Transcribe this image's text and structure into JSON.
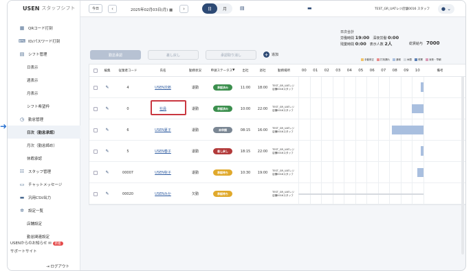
{
  "app": {
    "brand": "USEN",
    "brand_sub": "スタッフシフト"
  },
  "sidebar": {
    "items": [
      {
        "label": "QRコード打刻",
        "icon": "qr-icon",
        "sub": false
      },
      {
        "label": "ID/パスワード打刻",
        "icon": "keyboard-icon",
        "sub": false
      },
      {
        "label": "シフト管理",
        "icon": "calendar-icon",
        "sub": false
      },
      {
        "label": "日表示",
        "sub": true
      },
      {
        "label": "週表示",
        "sub": true
      },
      {
        "label": "月表示",
        "sub": true
      },
      {
        "label": "シフト希望枠",
        "sub": true
      },
      {
        "label": "勤怠管理",
        "icon": "check-circle-icon",
        "sub": false
      },
      {
        "label": "日次（勤怠承認）",
        "sub": true,
        "active": true
      },
      {
        "label": "月次（勤怠締め）",
        "sub": true
      },
      {
        "label": "休暇承認",
        "sub": true
      },
      {
        "label": "スタッフ管理",
        "icon": "people-icon",
        "sub": false
      },
      {
        "label": "チャットメッセージ",
        "icon": "chat-icon",
        "sub": false
      },
      {
        "label": "汎用CSV出力",
        "icon": "csv-icon",
        "sub": false
      },
      {
        "label": "設定一覧",
        "icon": "gear-icon",
        "sub": false
      },
      {
        "label": "店舗設定",
        "sub": true
      },
      {
        "label": "勤怠関連設定",
        "sub": true
      }
    ],
    "news": "USENからのお知らせ",
    "news_badge": "新着",
    "support": "サポートサイト",
    "logout": "ログアウト"
  },
  "topbar": {
    "today": "今日",
    "date": "2025年02月03日(月)",
    "view_day": "日",
    "view_month": "月",
    "shop": "TEST_GR_UATレジ店舗0016 スタッフ"
  },
  "summary": {
    "line1": "日次合計",
    "labor_label": "労働時間",
    "labor": "19:00",
    "night_label": "深夜労働",
    "night": "0:00",
    "overtime_label": "残業時間",
    "overtime": "0:00",
    "people_label": "表示人数",
    "people": "2人",
    "total_label": "総賃給与",
    "total": "7000"
  },
  "actions": {
    "approve": "勤怠承認",
    "reject": "差し戻し",
    "cancel": "承認取り消し",
    "add": "追加"
  },
  "legend": [
    {
      "label": "手動修正",
      "color": "#f0c36a"
    },
    {
      "label": "打刻漏れ",
      "color": "#e98c8c"
    },
    {
      "label": "通常",
      "color": "#a9bfdf"
    },
    {
      "label": "休憩",
      "color": "#d5d9de"
    },
    {
      "label": "残業",
      "color": "#5a7fb5"
    },
    {
      "label": "深夜・早朝",
      "color": "#d99bb6"
    }
  ],
  "table": {
    "headers": [
      "編集",
      "従業者コード",
      "氏名",
      "勤務状況",
      "申請ステータス",
      "出社",
      "退社",
      "勤務場所"
    ],
    "hours": [
      "00",
      "01",
      "02",
      "03",
      "04",
      "05",
      "06",
      "07",
      "08",
      "09",
      "10"
    ],
    "memo": "備考",
    "rows": [
      {
        "code": "4",
        "name": "USEN次郎",
        "work": "退勤",
        "status": "承認済み",
        "st": "green",
        "in": "11:00",
        "out": "18:00",
        "loc": "TEST_GR_UATレジ店舗0016スタッフ"
      },
      {
        "code": "0",
        "name": "社員",
        "work": "退勤",
        "status": "承認済み",
        "st": "green",
        "in": "10:00",
        "out": "22:00",
        "loc": "TEST_GR_UATレジ店舗0016スタッフ"
      },
      {
        "code": "6",
        "name": "USEN夏子",
        "work": "退勤",
        "status": "未申請",
        "st": "gray",
        "in": "08:15",
        "out": "16:00",
        "loc": "TEST_GR_UATレジ店舗0016スタッフ"
      },
      {
        "code": "5",
        "name": "USEN春子",
        "work": "退勤",
        "status": "差し戻し",
        "st": "red",
        "in": "18:15",
        "out": "22:00",
        "loc": "TEST_GR_UATレジ店舗0016スタッフ"
      },
      {
        "code": "00007",
        "name": "USEN秋子",
        "work": "退勤",
        "status": "承認待ち",
        "st": "yellow",
        "in": "10:30",
        "out": "19:00",
        "loc": "TEST_GR_UATレジ店舗0016スタッフ"
      },
      {
        "code": "00020",
        "name": "USENみか",
        "work": "欠勤",
        "status": "承認待ち",
        "st": "yellow",
        "in": "",
        "out": "",
        "loc": "TEST_GR_UATレジ店舗0016スタッフ"
      }
    ]
  }
}
